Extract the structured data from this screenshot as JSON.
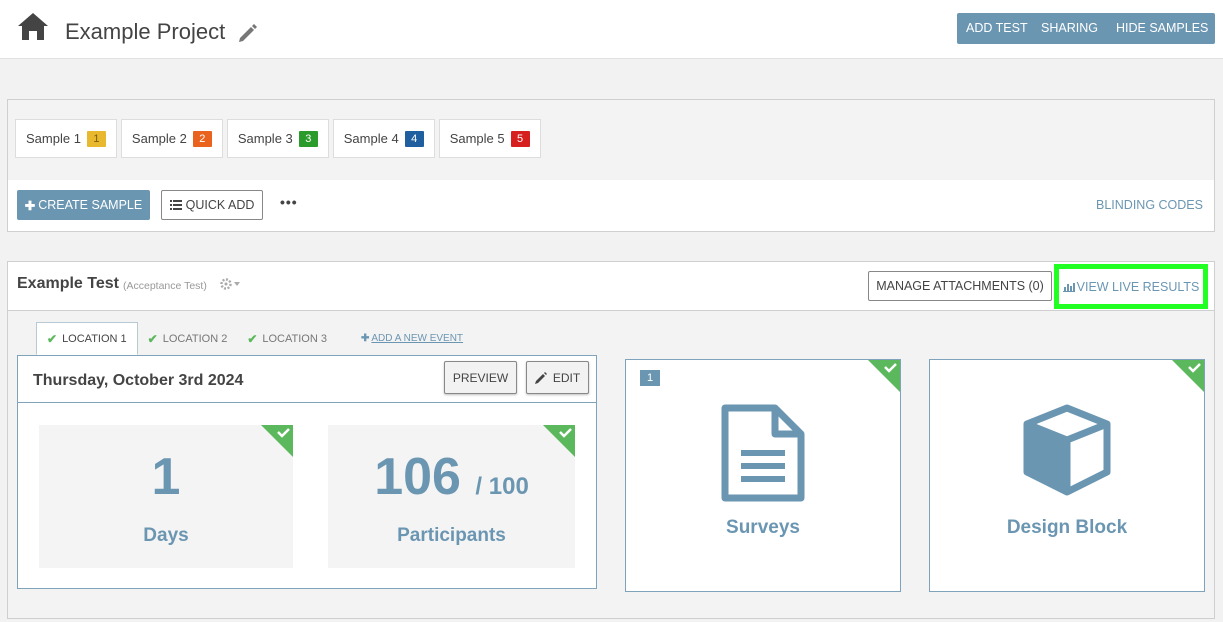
{
  "header": {
    "project_title": "Example Project",
    "buttons": {
      "add_test": "ADD TEST",
      "sharing": "SHARING",
      "hide_samples": "HIDE SAMPLES"
    }
  },
  "samples": {
    "items": [
      {
        "label": "Sample 1",
        "badge": "1",
        "color": "#e8b92f"
      },
      {
        "label": "Sample 2",
        "badge": "2",
        "color": "#e9621e"
      },
      {
        "label": "Sample 3",
        "badge": "3",
        "color": "#2b9b2b"
      },
      {
        "label": "Sample 4",
        "badge": "4",
        "color": "#1f5fa0"
      },
      {
        "label": "Sample 5",
        "badge": "5",
        "color": "#d61f1f"
      }
    ],
    "create_label": "CREATE SAMPLE",
    "quick_add_label": "QUICK ADD",
    "more_label": "•••",
    "blinding_label": "BLINDING CODES"
  },
  "test": {
    "title": "Example Test",
    "type": "(Acceptance Test)",
    "manage_label": "MANAGE ATTACHMENTS (0)",
    "live_label": "VIEW LIVE RESULTS",
    "tabs": [
      {
        "label": "LOCATION 1"
      },
      {
        "label": "LOCATION 2"
      },
      {
        "label": "LOCATION 3"
      }
    ],
    "add_event_label": "ADD A NEW EVENT",
    "event": {
      "date": "Thursday, October 3rd 2024",
      "preview_label": "PREVIEW",
      "edit_label": "EDIT",
      "days_value": "1",
      "days_label": "Days",
      "participants_value": "106",
      "participants_denom": "/ 100",
      "participants_label": "Participants"
    },
    "blocks": [
      {
        "label": "Surveys",
        "badge": "1"
      },
      {
        "label": "Design Block"
      }
    ]
  },
  "colors": {
    "accent": "#6b96b2",
    "check_green": "#5cb85c",
    "highlight": "#22ff22"
  }
}
